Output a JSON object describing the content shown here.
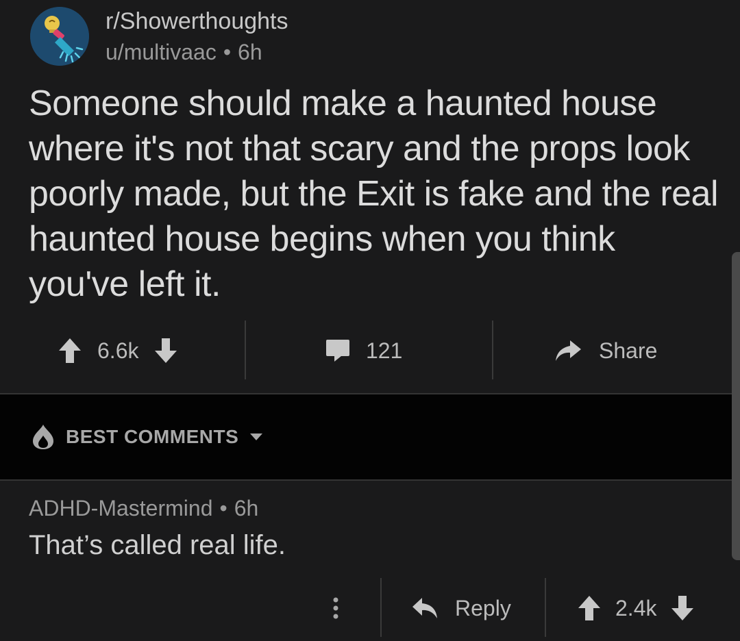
{
  "post": {
    "subreddit": "r/Showerthoughts",
    "author": "u/multivaac",
    "separator": "•",
    "age": "6h",
    "title": "Someone should make a haunted house where it's not that scary and the props look poorly made, but the Exit is fake and the real haunted house begins when you think you've left it.",
    "votes": "6.6k",
    "comment_count": "121",
    "share_label": "Share",
    "icons": {
      "avatar": "shower-head-icon",
      "upvote": "upvote-arrow-icon",
      "downvote": "downvote-arrow-icon",
      "comment": "comment-bubble-icon",
      "share": "share-arrow-icon"
    }
  },
  "sort": {
    "label": "BEST COMMENTS",
    "icons": {
      "sort": "flame-icon",
      "dropdown": "caret-down-icon"
    }
  },
  "comment": {
    "author": "ADHD-Mastermind",
    "separator": "•",
    "age": "6h",
    "body": "That’s called real life.",
    "reply_label": "Reply",
    "votes": "2.4k",
    "icons": {
      "more": "vertical-dots-icon",
      "reply": "reply-arrow-icon",
      "upvote": "upvote-arrow-icon",
      "downvote": "downvote-arrow-icon"
    }
  },
  "colors": {
    "background": "#1a1a1b",
    "sort_bar_background": "#030303",
    "primary_text": "#d7dadc",
    "secondary_text": "#9a9a9a",
    "divider": "#343434",
    "avatar_background": "#1d4a6e"
  }
}
